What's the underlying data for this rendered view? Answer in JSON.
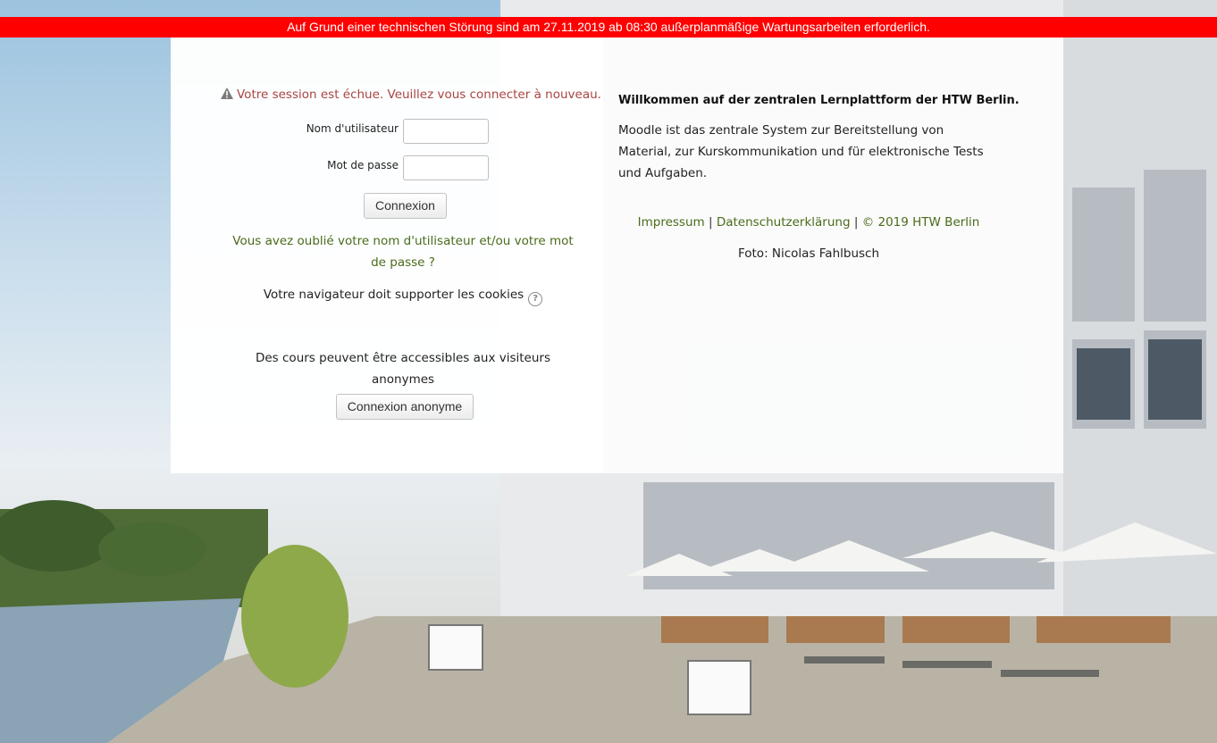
{
  "banner": {
    "text": "Auf Grund einer technischen Störung sind am 27.11.2019 ab 08:30 außerplanmäßige Wartungsarbeiten erforderlich."
  },
  "login": {
    "session_message": "Votre session est échue. Veuillez vous connecter à nouveau.",
    "username_label": "Nom d'utilisateur",
    "username_value": "",
    "password_label": "Mot de passe",
    "password_value": "",
    "login_button": "Connexion",
    "forgot_link": "Vous avez oublié votre nom d'utilisateur et/ou votre mot de passe ?",
    "cookies_text": "Votre navigateur doit supporter les cookies",
    "guest_text": "Des cours peuvent être accessibles aux visiteurs anonymes",
    "guest_button": "Connexion anonyme"
  },
  "info": {
    "welcome_title": "Willkommen auf der zentralen Lernplattform der HTW Berlin.",
    "welcome_text": "Moodle ist das zentrale System zur Bereitstellung von Material, zur Kurskommunikation und für elektronische Tests und Aufgaben.",
    "footer_impressum": "Impressum",
    "footer_datenschutz": "Datenschutzerklärung",
    "footer_copyright": "© 2019 HTW Berlin",
    "photo_credit": "Foto: Nicolas Fahlbusch"
  },
  "icons": {
    "warning": "warning-icon",
    "help": "help-icon"
  },
  "colors": {
    "banner_bg": "#ff0000",
    "error_text": "#a94442",
    "link": "#4a6b1a"
  }
}
